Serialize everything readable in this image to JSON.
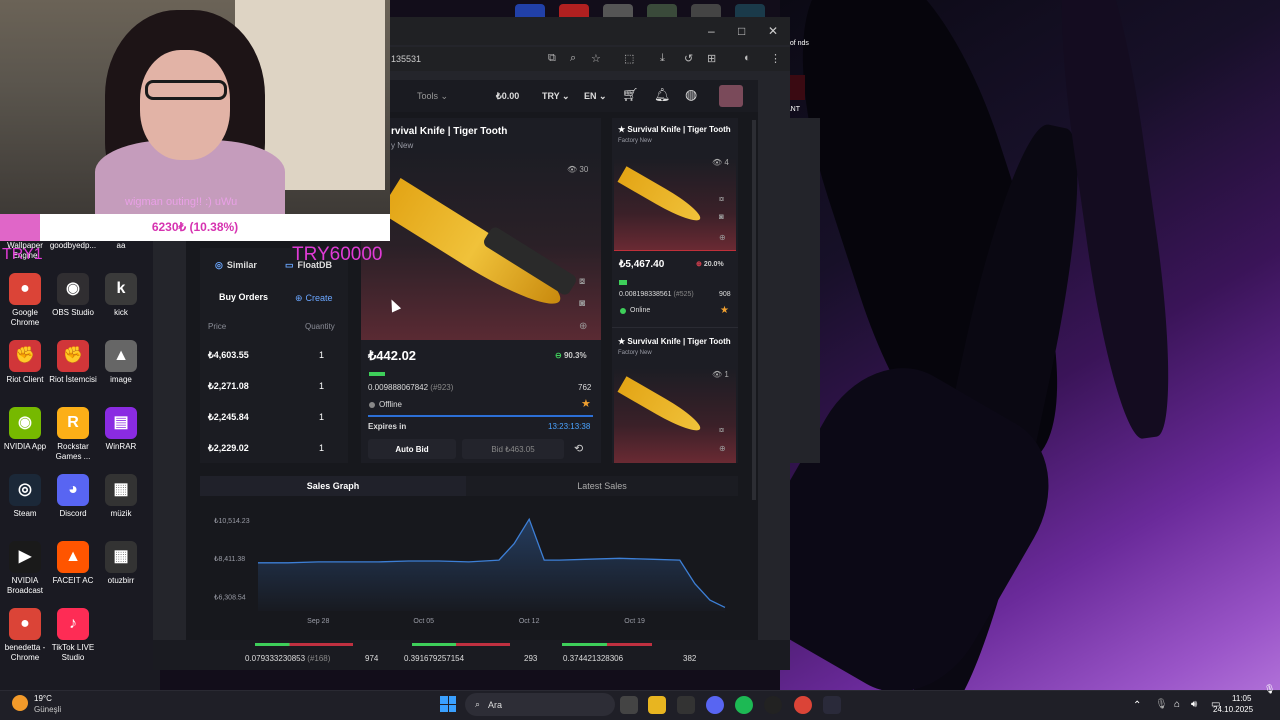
{
  "browser": {
    "url": "135531",
    "window_controls": {
      "minimize": "–",
      "maximize": "□",
      "close": "✕"
    }
  },
  "site_header": {
    "tools": "Tools",
    "balance": "₺0.00",
    "currency": "TRY",
    "language": "EN"
  },
  "left_panel": {
    "similar_label": "Similar",
    "floatdb_label": "FloatDB",
    "buy_orders_title": "Buy Orders",
    "create_label": "Create",
    "col_price": "Price",
    "col_quantity": "Quantity",
    "rows": [
      {
        "price": "₺4,603.55",
        "qty": "1"
      },
      {
        "price": "₺2,271.08",
        "qty": "1"
      },
      {
        "price": "₺2,245.84",
        "qty": "1"
      },
      {
        "price": "₺2,229.02",
        "qty": "1"
      }
    ]
  },
  "main_item": {
    "title": "rvival Knife | Tiger Tooth",
    "subtitle": "y New",
    "views": "30",
    "price": "₺442.02",
    "percent": "90.3%",
    "float": "0.009888067842",
    "float_rank": "(#923)",
    "pattern": "762",
    "status": "Offline",
    "expires_label": "Expires in",
    "timer": "13:23:13:38",
    "auto_bid": "Auto Bid",
    "bid_label": "Bid ₺463.05"
  },
  "side_items": [
    {
      "title": "★ Survival Knife | Tiger Tooth",
      "subtitle": "Factory New",
      "views": "4",
      "price": "₺5,467.40",
      "percent": "20.0%",
      "float": "0.008198338561",
      "float_rank": "(#525)",
      "pattern": "908",
      "status": "Online"
    },
    {
      "title": "★ Survival Knife | Tiger Tooth",
      "subtitle": "Factory New",
      "views": "1"
    }
  ],
  "tabs": {
    "sales_graph": "Sales Graph",
    "latest_sales": "Latest Sales"
  },
  "chart_data": {
    "type": "line",
    "y_ticks": [
      "₺10,514.23",
      "₺8,411.38",
      "₺6,308.54"
    ],
    "x_ticks": [
      "Sep 28",
      "Oct 05",
      "Oct 12",
      "Oct 19"
    ],
    "x": [
      "Sep 24",
      "Sep 26",
      "Sep 28",
      "Sep 30",
      "Oct 02",
      "Oct 04",
      "Oct 06",
      "Oct 08",
      "Oct 10",
      "Oct 11",
      "Oct 12",
      "Oct 13",
      "Oct 14",
      "Oct 16",
      "Oct 18",
      "Oct 20",
      "Oct 22",
      "Oct 23",
      "Oct 24",
      "Oct 25"
    ],
    "values": [
      8150,
      8150,
      8200,
      8200,
      8200,
      8250,
      8250,
      8200,
      8300,
      9200,
      10550,
      8300,
      8300,
      8350,
      8400,
      8350,
      8300,
      7000,
      6100,
      5700
    ],
    "ylim": [
      5500,
      11000
    ],
    "color": "#3d7fd6"
  },
  "footer": [
    {
      "float": "0.079333230853",
      "rank": "(#168)",
      "pattern": "974"
    },
    {
      "float": "0.391679257154",
      "pattern": "293"
    },
    {
      "float": "0.374421328306",
      "pattern": "382"
    }
  ],
  "overlay": {
    "caption": "wigman outing!! :) uWu",
    "donation": "6230₺ (10.38%)",
    "goal_text": "TRY60000",
    "goal_left": "TRY1"
  },
  "desktop_icons": [
    {
      "label": "Wallpaper Engine",
      "color": "#2b6fd6",
      "glyph": "W"
    },
    {
      "label": "goodbyedp...",
      "color": "#444",
      "glyph": "g"
    },
    {
      "label": "aa",
      "color": "#555",
      "glyph": "a"
    },
    {
      "label": "Google Chrome",
      "color": "#db4437",
      "glyph": "●"
    },
    {
      "label": "OBS Studio",
      "color": "#302e31",
      "glyph": "◉"
    },
    {
      "label": "kick",
      "color": "#3a3a3a",
      "glyph": "k"
    },
    {
      "label": "Riot Client",
      "color": "#d13639",
      "glyph": "✊"
    },
    {
      "label": "Riot İstemcisi",
      "color": "#d13639",
      "glyph": "✊"
    },
    {
      "label": "image",
      "color": "#666",
      "glyph": "▲"
    },
    {
      "label": "NVIDIA App",
      "color": "#76b900",
      "glyph": "◉"
    },
    {
      "label": "Rockstar Games ...",
      "color": "#fcaf17",
      "glyph": "R"
    },
    {
      "label": "WinRAR",
      "color": "#8a2be2",
      "glyph": "▤"
    },
    {
      "label": "Steam",
      "color": "#1b2838",
      "glyph": "◎"
    },
    {
      "label": "Discord",
      "color": "#5865f2",
      "glyph": "◕"
    },
    {
      "label": "müzik",
      "color": "#333",
      "glyph": "▦"
    },
    {
      "label": "NVIDIA Broadcast",
      "color": "#1a1a1a",
      "glyph": "▶"
    },
    {
      "label": "FACEIT AC",
      "color": "#ff5500",
      "glyph": "▲"
    },
    {
      "label": "otuzbirr",
      "color": "#333",
      "glyph": "▦"
    },
    {
      "label": "benedetta - Chrome",
      "color": "#db4437",
      "glyph": "●"
    },
    {
      "label": "TikTok LIVE Studio",
      "color": "#fe2c55",
      "glyph": "♪"
    }
  ],
  "right_window_text": {
    "top": "e of nds",
    "bottom": "ANT"
  },
  "taskbar": {
    "weather_temp": "19°C",
    "weather_label": "Güneşli",
    "search_label": "Ara",
    "time": "11:05",
    "date": "24.10.2025"
  }
}
